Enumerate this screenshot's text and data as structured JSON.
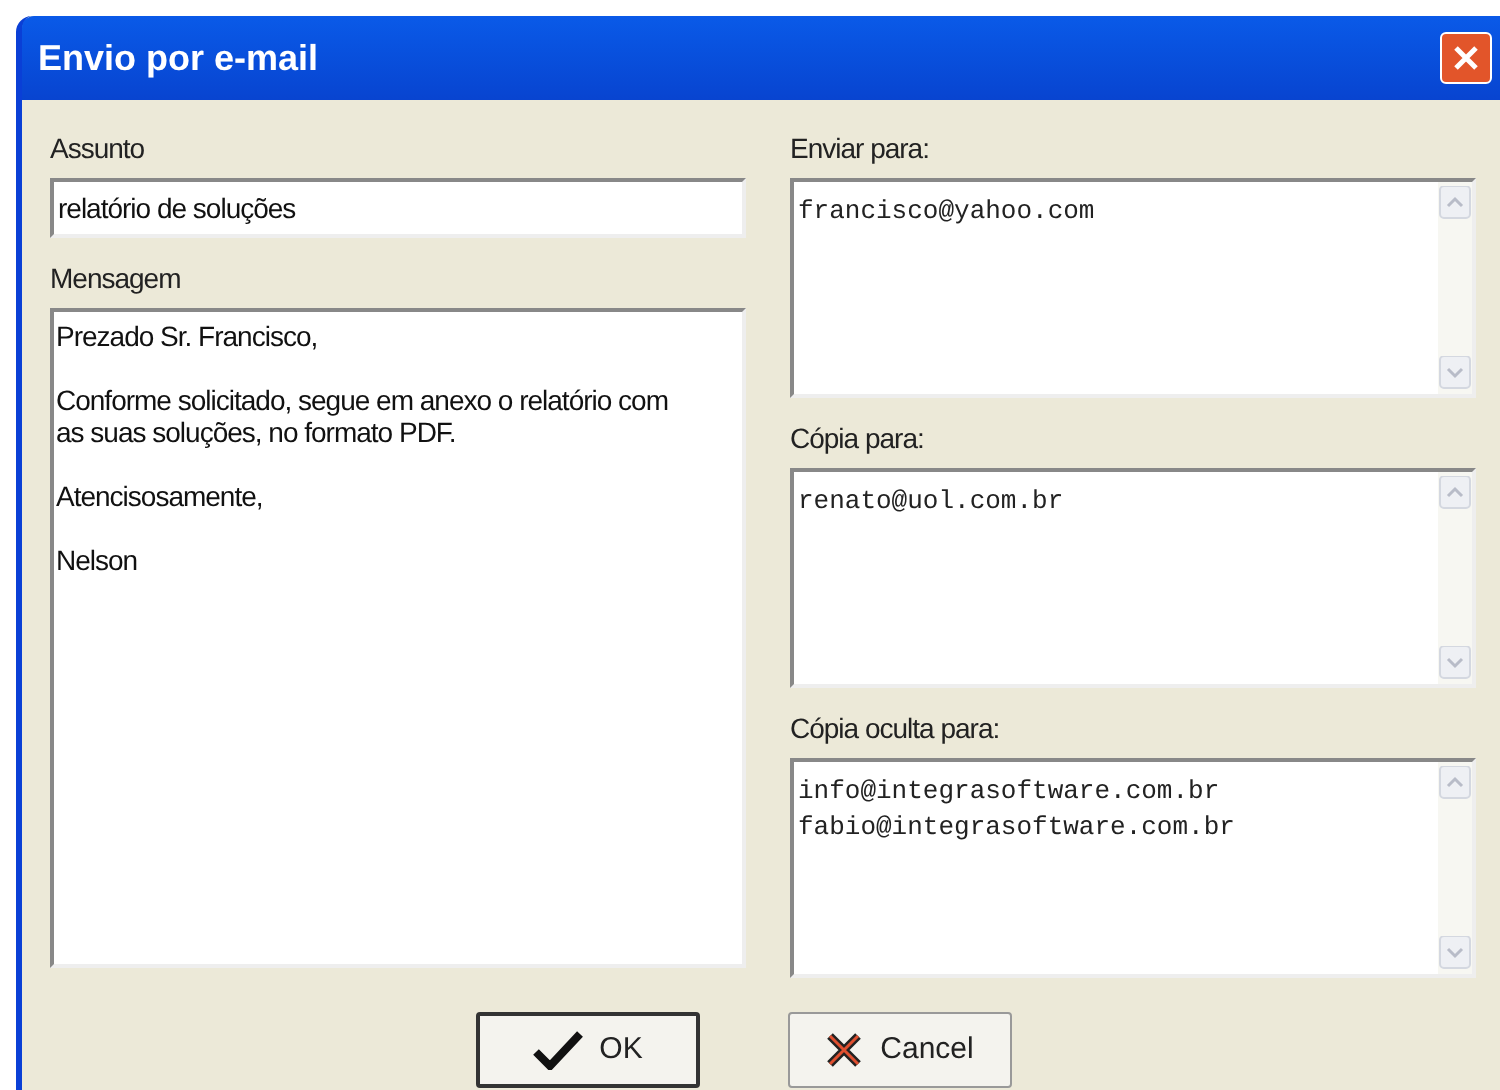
{
  "window": {
    "title": "Envio por e-mail"
  },
  "subject": {
    "label": "Assunto",
    "value": "relatório de soluções"
  },
  "message": {
    "label": "Mensagem",
    "paragraphs": [
      "Prezado Sr. Francisco,",
      "Conforme solicitado, segue em anexo o relatório com as suas soluções, no formato PDF.",
      "Atencisosamente,",
      "Nelson"
    ]
  },
  "recipients": [
    {
      "label": "Enviar para:",
      "lines": [
        "francisco@yahoo.com"
      ]
    },
    {
      "label": "Cópia para:",
      "lines": [
        "renato@uol.com.br"
      ]
    },
    {
      "label": "Cópia oculta para:",
      "lines": [
        "info@integrasoftware.com.br",
        "fabio@integrasoftware.com.br"
      ]
    }
  ],
  "buttons": [
    {
      "label": "OK",
      "kind": "ok"
    },
    {
      "label": "Cancel",
      "kind": "cancel"
    }
  ]
}
